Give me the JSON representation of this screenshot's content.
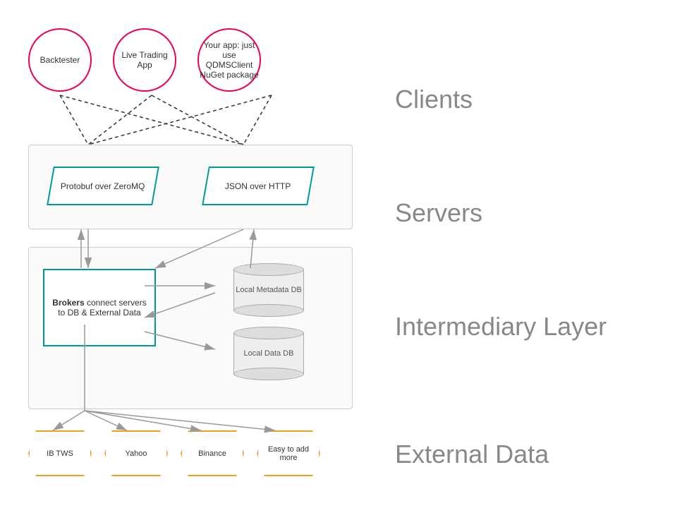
{
  "labels": {
    "clients": "Clients",
    "servers": "Servers",
    "intermediary": "Intermediary Layer",
    "external": "External Data"
  },
  "clients": [
    {
      "id": "backtester",
      "label": "Backtester"
    },
    {
      "id": "live-trading",
      "label": "Live Trading App"
    },
    {
      "id": "your-app",
      "label": "Your app: just use QDMSClient NuGet package"
    }
  ],
  "servers": [
    {
      "id": "protobuf",
      "label": "Protobuf over ZeroMQ"
    },
    {
      "id": "json",
      "label": "JSON over HTTP"
    }
  ],
  "broker": {
    "label": "Brokers connect servers to DB & External Data",
    "bold": "Brokers"
  },
  "databases": [
    {
      "id": "metadata-db",
      "label": "Local Metadata DB"
    },
    {
      "id": "data-db",
      "label": "Local Data DB"
    }
  ],
  "external": [
    {
      "id": "ib-tws",
      "label": "IB TWS"
    },
    {
      "id": "yahoo",
      "label": "Yahoo"
    },
    {
      "id": "binance",
      "label": "Binance"
    },
    {
      "id": "easy-add",
      "label": "Easy to add more"
    }
  ]
}
